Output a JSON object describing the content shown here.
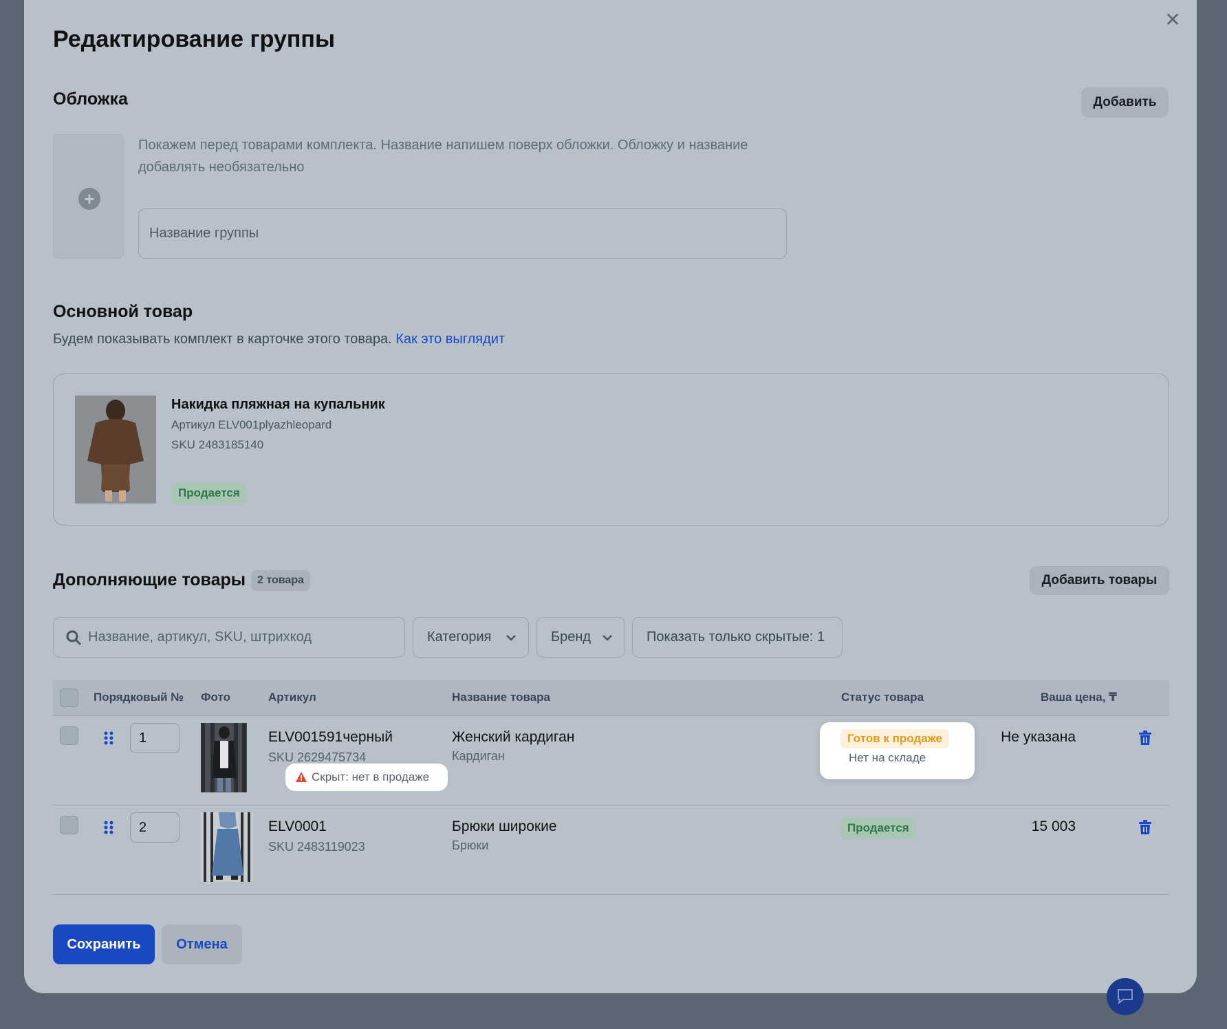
{
  "modal": {
    "title": "Редактирование группы",
    "close_label": "✕"
  },
  "cover": {
    "title": "Обложка",
    "add_label": "Добавить",
    "hint_line1": "Покажем перед товарами комплекта. Название напишем поверх обложки. Обложку и название",
    "hint_line2": "добавлять необязательно",
    "name_placeholder": "Название группы",
    "name_value": ""
  },
  "main_product": {
    "title": "Основной товар",
    "subtitle": "Будем показывать комплект в карточке этого товара.",
    "link_label": "Как это выглядит",
    "product_name": "Накидка пляжная на купальник",
    "article": "Артикул ELV001plyazhleopard",
    "sku": "SKU 2483185140",
    "status": "Продается"
  },
  "additional": {
    "title": "Дополняющие товары",
    "count_badge": "2 товара",
    "add_label": "Добавить товары",
    "search_placeholder": "Название, артикул, SKU, штрихкод",
    "filter_category": "Категория",
    "filter_brand": "Бренд",
    "filter_hidden": "Показать только скрытые: 1"
  },
  "table": {
    "headers": {
      "order": "Порядковый №",
      "photo": "Фото",
      "article": "Артикул",
      "name": "Название товара",
      "status": "Статус товара",
      "price": "Ваша цена, ₸"
    },
    "rows": [
      {
        "order": "1",
        "article": "ELV001591черный",
        "sku": "SKU 2629475734",
        "hidden_note": "Скрыт: нет в продаже",
        "name": "Женский кардиган",
        "category": "Кардиган",
        "status": "Готов к продаже",
        "status_sub": "Нет на складе",
        "price": "Не указана"
      },
      {
        "order": "2",
        "article": "ELV0001",
        "sku": "SKU 2483119023",
        "name": "Брюки широкие",
        "category": "Брюки",
        "status": "Продается",
        "price": "15 003"
      }
    ]
  },
  "footer": {
    "save_label": "Сохранить",
    "cancel_label": "Отмена"
  },
  "colors": {
    "primary": "#1a47c2",
    "success_text": "#2d7a45",
    "warning_text": "#e39b16",
    "danger_icon": "#e5472f"
  },
  "icons": [
    "close-icon",
    "plus-icon",
    "search-icon",
    "chevron-down-icon",
    "drag-handle-icon",
    "trash-icon",
    "warning-icon",
    "chat-icon"
  ]
}
